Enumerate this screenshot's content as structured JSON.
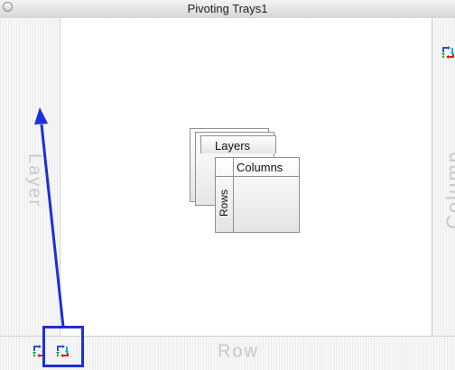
{
  "window": {
    "title": "Pivoting Trays1"
  },
  "trays": {
    "layer_label": "Layer",
    "column_label": "Column",
    "row_label": "Row"
  },
  "center_diagram": {
    "layers_label": "Layers",
    "columns_label": "Columns",
    "rows_label": "Rows"
  },
  "colors": {
    "annotation_blue": "#1d2fd6",
    "tray_label_gray": "#c8c8c8",
    "pivot_blue": "#2a4fd8",
    "pivot_cyan": "#18b0c8",
    "pivot_green": "#12a83a",
    "pivot_red": "#d82020"
  },
  "icons": [
    "pivot-icon",
    "pivot-icon",
    "pivot-icon"
  ]
}
